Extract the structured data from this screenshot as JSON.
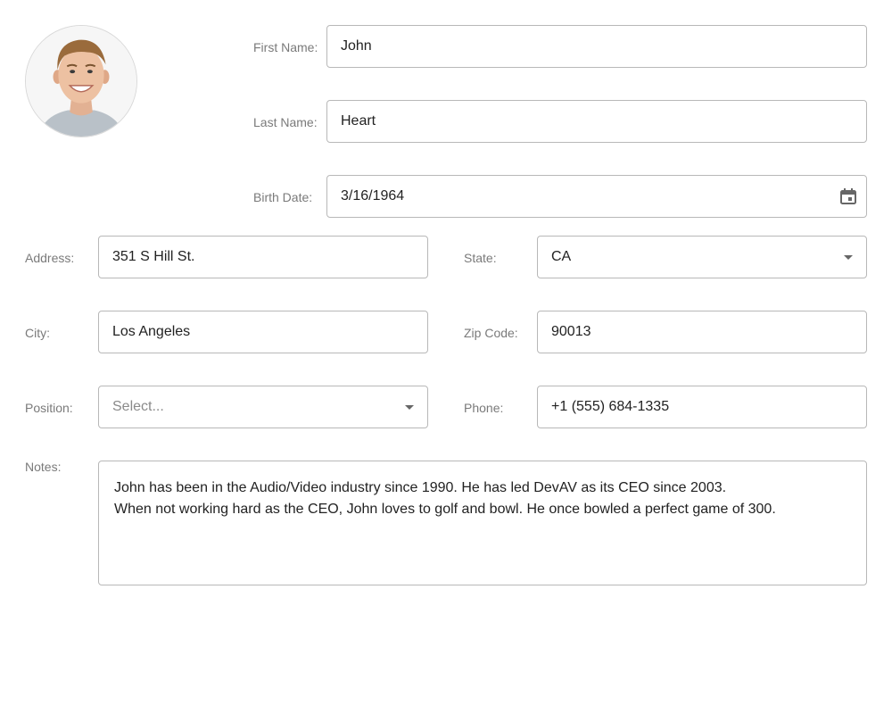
{
  "photo": {
    "alt": "John Heart"
  },
  "first_name": {
    "label": "First Name:",
    "value": "John"
  },
  "last_name": {
    "label": "Last Name:",
    "value": "Heart"
  },
  "birth_date": {
    "label": "Birth Date:",
    "value": "3/16/1964",
    "icon": "calendar-icon"
  },
  "address": {
    "label": "Address:",
    "value": "351 S Hill St."
  },
  "state": {
    "label": "State:",
    "value": "CA",
    "icon": "chevron-down-icon"
  },
  "city": {
    "label": "City:",
    "value": "Los Angeles"
  },
  "zip": {
    "label": "Zip Code:",
    "value": "90013"
  },
  "position": {
    "label": "Position:",
    "placeholder": "Select...",
    "icon": "chevron-down-icon"
  },
  "phone": {
    "label": "Phone:",
    "value": "+1 (555) 684-1335"
  },
  "notes": {
    "label": "Notes:",
    "lines": [
      "John has been in the Audio/Video industry since 1990. He has led DevAV as its CEO since 2003.",
      "When not working hard as the CEO, John loves to golf and bowl. He once bowled a perfect game of 300."
    ]
  },
  "colors": {
    "label": "#7a7a7a",
    "border": "#b8b8b8",
    "text": "#222222",
    "icon": "#666666"
  }
}
